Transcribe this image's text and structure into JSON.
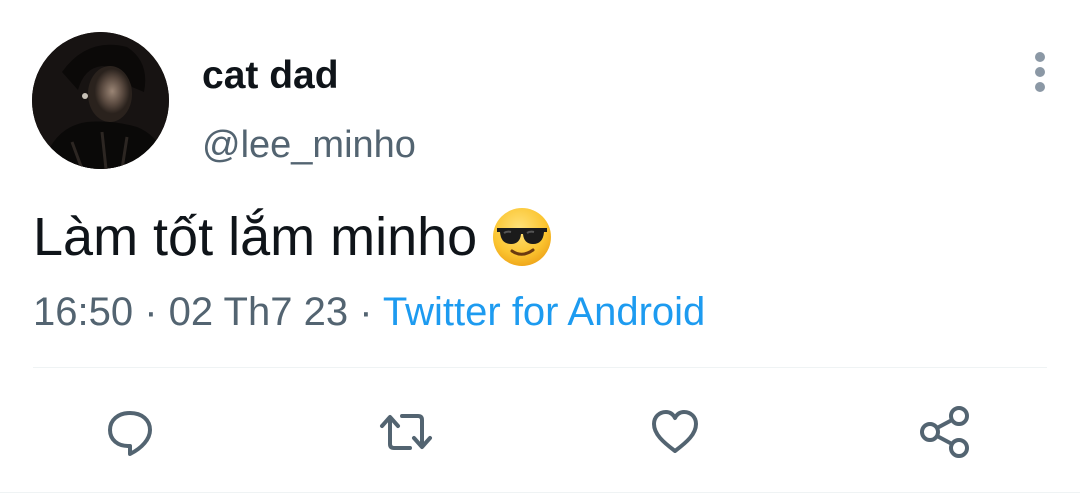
{
  "tweet": {
    "display_name": "cat dad",
    "username": "@lee_minho",
    "text": "Làm tốt lắm minho",
    "emoji_icon": "sunglasses-face-emoji",
    "time": "16:50",
    "separator": " · ",
    "date": "02 Th7 23",
    "source": "Twitter for Android"
  },
  "actions": {
    "reply_icon": "reply-icon",
    "retweet_icon": "retweet-icon",
    "like_icon": "heart-icon",
    "share_icon": "share-icon"
  },
  "colors": {
    "text_primary": "#0f1419",
    "text_secondary": "#536471",
    "link": "#1d9bf0",
    "icon": "#536471",
    "divider": "#eff3f4"
  }
}
